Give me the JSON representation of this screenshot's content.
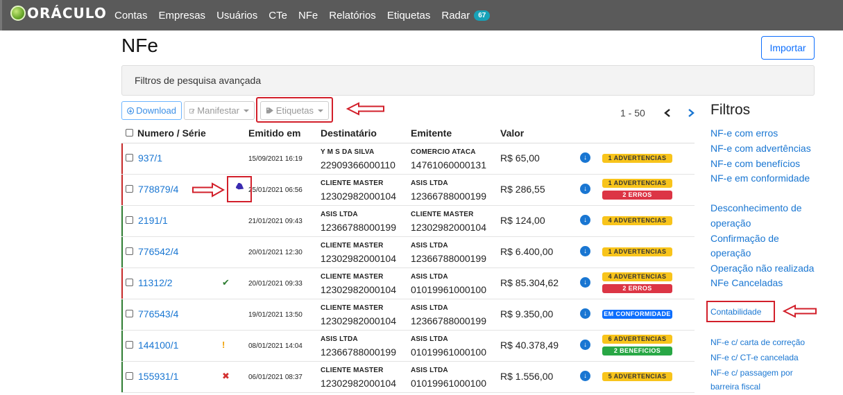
{
  "navbar": {
    "brand": "ORÁCULO",
    "items": [
      "Contas",
      "Empresas",
      "Usuários",
      "CTe",
      "NFe",
      "Relatórios",
      "Etiquetas"
    ],
    "radar_label": "Radar",
    "radar_count": "67"
  },
  "page": {
    "title": "NFe",
    "import_label": "Importar",
    "filters_label": "Filtros de pesquisa avançada"
  },
  "toolbar": {
    "download_label": "Download",
    "manifestar_label": "Manifestar",
    "etiquetas_label": "Etiquetas",
    "pagination": "1 - 50"
  },
  "table": {
    "headers": {
      "numero": "Numero / Série",
      "emitido": "Emitido em",
      "destinatario": "Destinatário",
      "emitente": "Emitente",
      "valor": "Valor"
    },
    "rows": [
      {
        "numero": "937/1",
        "date": "15/09/2021 16:19",
        "dest_name": "Y M S DA SILVA",
        "dest_cnpj": "22909366000110",
        "emit_name": "COMERCIO ATACA",
        "emit_cnpj": "14761060000131",
        "valor": "R$ 65,00",
        "status": "",
        "badges": [
          "1 ADVERTENCIAS"
        ]
      },
      {
        "numero": "778879/4",
        "date": "25/01/2021 06:56",
        "dest_name": "CLIENTE MASTER",
        "dest_cnpj": "12302982000104",
        "emit_name": "ASIS LTDA",
        "emit_cnpj": "12366788000199",
        "valor": "R$ 286,55",
        "status": "",
        "badges": [
          "1 ADVERTENCIAS",
          "2 ERROS"
        ]
      },
      {
        "numero": "2191/1",
        "date": "21/01/2021 09:43",
        "dest_name": "ASIS LTDA",
        "dest_cnpj": "12366788000199",
        "emit_name": "CLIENTE MASTER",
        "emit_cnpj": "12302982000104",
        "valor": "R$ 124,00",
        "status": "",
        "badges": [
          "4 ADVERTENCIAS"
        ]
      },
      {
        "numero": "776542/4",
        "date": "20/01/2021 12:30",
        "dest_name": "CLIENTE MASTER",
        "dest_cnpj": "12302982000104",
        "emit_name": "ASIS LTDA",
        "emit_cnpj": "12366788000199",
        "valor": "R$ 6.400,00",
        "status": "",
        "badges": [
          "1 ADVERTENCIAS"
        ]
      },
      {
        "numero": "11312/2",
        "date": "20/01/2021 09:33",
        "dest_name": "CLIENTE MASTER",
        "dest_cnpj": "12302982000104",
        "emit_name": "ASIS LTDA",
        "emit_cnpj": "01019961000100",
        "valor": "R$ 85.304,62",
        "status": "✔",
        "badges": [
          "4 ADVERTENCIAS",
          "2 ERROS"
        ]
      },
      {
        "numero": "776543/4",
        "date": "19/01/2021 13:50",
        "dest_name": "CLIENTE MASTER",
        "dest_cnpj": "12302982000104",
        "emit_name": "ASIS LTDA",
        "emit_cnpj": "12366788000199",
        "valor": "R$ 9.350,00",
        "status": "",
        "badges": [
          "EM CONFORMIDADE"
        ]
      },
      {
        "numero": "144100/1",
        "date": "08/01/2021 14:04",
        "dest_name": "ASIS LTDA",
        "dest_cnpj": "12366788000199",
        "emit_name": "ASIS LTDA",
        "emit_cnpj": "01019961000100",
        "valor": "R$ 40.378,49",
        "status": "!",
        "badges": [
          "6 ADVERTENCIAS",
          "2 BENEFICIOS"
        ]
      },
      {
        "numero": "155931/1",
        "date": "06/01/2021 08:37",
        "dest_name": "CLIENTE MASTER",
        "dest_cnpj": "12302982000104",
        "emit_name": "ASIS LTDA",
        "emit_cnpj": "01019961000100",
        "valor": "R$ 1.556,00",
        "status": "✖",
        "badges": [
          "5 ADVERTENCIAS"
        ]
      }
    ]
  },
  "sidebar": {
    "title": "Filtros",
    "group1": [
      "NF-e com erros",
      "NF-e com advertências",
      "NF-e com benefícios",
      "NF-e em conformidade"
    ],
    "group2": [
      "Desconhecimento de",
      "operação",
      "Confirmação de",
      "operação",
      "Operação não realizada",
      "NFe Canceladas"
    ],
    "contabilidade": "Contabilidade",
    "group3": [
      "NF-e c/ carta de correção",
      "NF-e c/ CT-e cancelada",
      "NF-e c/ passagem por",
      "barreira fiscal"
    ]
  },
  "colors": {
    "navbar": "#5a5a5a",
    "link": "#1976d2",
    "warning": "#f8c41b",
    "error": "#dc3545",
    "success": "#28a745",
    "annotation": "#d21f2a"
  },
  "icons": {
    "download": "download-circle-icon",
    "tag": "tag-icon",
    "edit": "edit-icon",
    "prev": "chevron-left-icon",
    "next": "chevron-right-icon"
  }
}
